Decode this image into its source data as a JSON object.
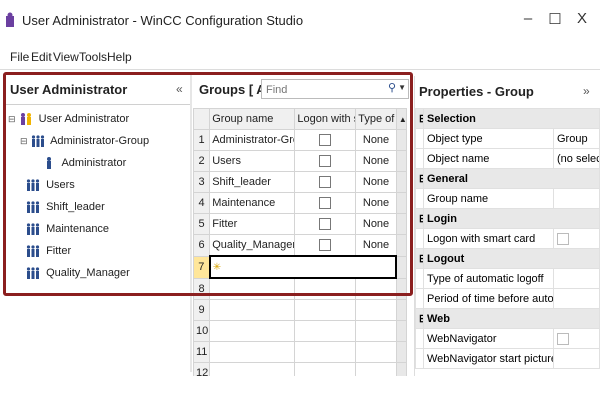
{
  "window": {
    "title": "User Administrator - WinCC Configuration Studio",
    "minimize": "–",
    "maximize": "☐",
    "close": "X"
  },
  "menu": [
    {
      "label": "File"
    },
    {
      "label": "Edit"
    },
    {
      "label": "View"
    },
    {
      "label": "Tools"
    },
    {
      "label": "Help"
    }
  ],
  "left": {
    "title": "User Administrator",
    "collapse": "«",
    "tree": [
      {
        "label": "User Administrator"
      },
      {
        "label": "Administrator-Group"
      },
      {
        "label": "Administrator"
      },
      {
        "label": "Users"
      },
      {
        "label": "Shift_leader"
      },
      {
        "label": "Maintenance"
      },
      {
        "label": "Fitter"
      },
      {
        "label": "Quality_Manager"
      }
    ]
  },
  "center": {
    "title": "Groups [ All ]",
    "find_placeholder": "Find",
    "columns": [
      "Group name",
      "Logon with smart",
      "Type of aut"
    ],
    "rows": [
      {
        "n": "1",
        "name": "Administrator-Group",
        "type": "None"
      },
      {
        "n": "2",
        "name": "Users",
        "type": "None"
      },
      {
        "n": "3",
        "name": "Shift_leader",
        "type": "None"
      },
      {
        "n": "4",
        "name": "Maintenance",
        "type": "None"
      },
      {
        "n": "5",
        "name": "Fitter",
        "type": "None"
      },
      {
        "n": "6",
        "name": "Quality_Manager",
        "type": "None"
      }
    ],
    "empty_rows": [
      "7",
      "8",
      "9",
      "10",
      "11",
      "12"
    ]
  },
  "props": {
    "title": "Properties - Group",
    "collapse": "»",
    "sections": [
      {
        "name": "Selection",
        "rows": [
          {
            "k": "Object type",
            "v": "Group"
          },
          {
            "k": "Object name",
            "v": "(no selectio"
          }
        ]
      },
      {
        "name": "General",
        "rows": [
          {
            "k": "Group name",
            "v": ""
          }
        ]
      },
      {
        "name": "Login",
        "rows": [
          {
            "k": "Logon with smart card",
            "v": "",
            "check": true
          }
        ]
      },
      {
        "name": "Logout",
        "rows": [
          {
            "k": "Type of automatic logoff",
            "v": ""
          },
          {
            "k": "Period of time before automatic logoff",
            "v": ""
          }
        ]
      },
      {
        "name": "Web",
        "rows": [
          {
            "k": "WebNavigator",
            "v": "",
            "check": true
          },
          {
            "k": "WebNavigator start picture",
            "v": ""
          }
        ]
      }
    ]
  },
  "colors": {
    "highlight": "#8b1f1f",
    "row_selected": "#ffffcc"
  }
}
